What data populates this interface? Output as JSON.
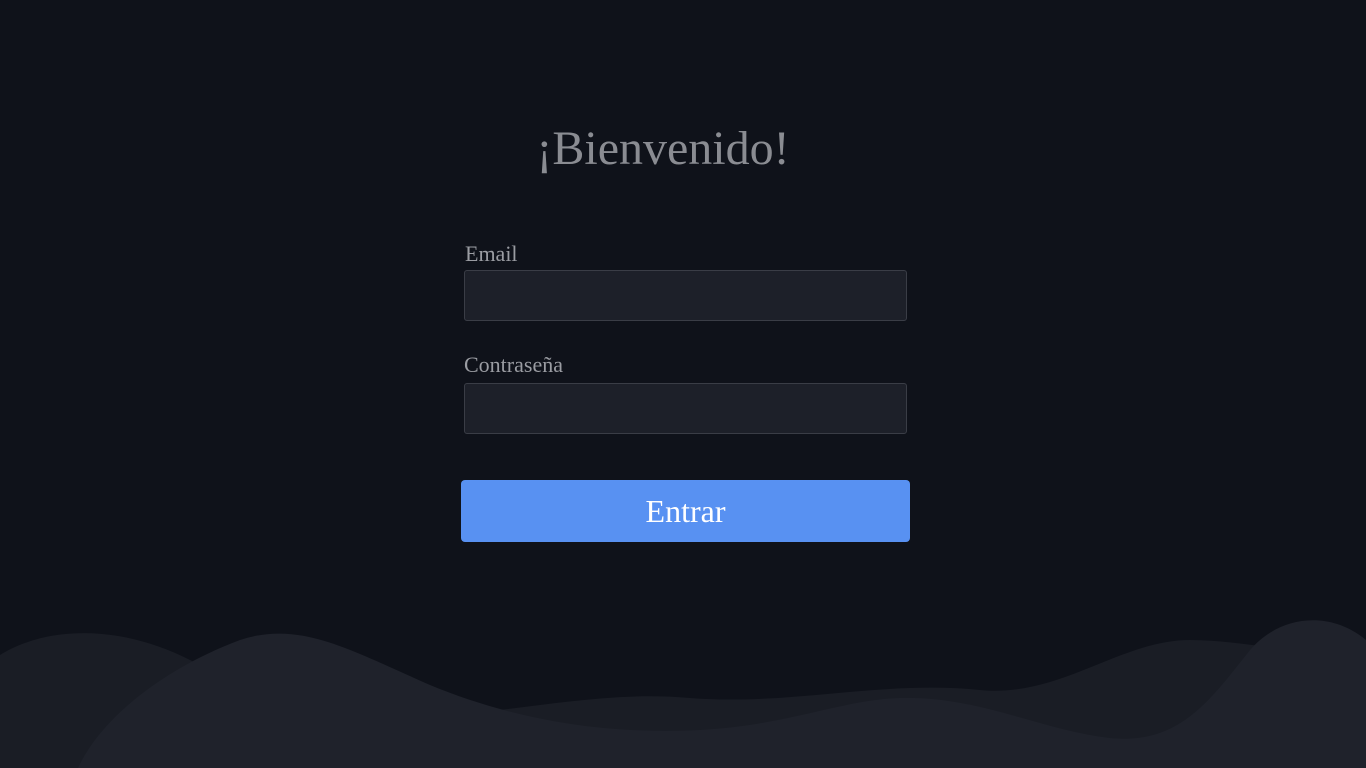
{
  "title": "¡Bienvenido!",
  "form": {
    "email_label": "Email",
    "email_value": "",
    "password_label": "Contraseña",
    "password_value": "",
    "submit_label": "Entrar"
  },
  "colors": {
    "background": "#0f121a",
    "wave": "#1d2029",
    "accent": "#5891f2",
    "input_bg": "#1d2029"
  }
}
